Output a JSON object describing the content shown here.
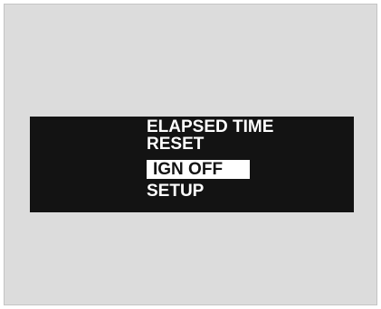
{
  "menu": {
    "items": [
      {
        "label": "ELAPSED TIME"
      },
      {
        "label": "RESET"
      },
      {
        "label": "IGN OFF",
        "selected": true
      },
      {
        "label": "SETUP"
      }
    ]
  },
  "colors": {
    "background": "#dcdcdc",
    "display": "#131313",
    "text": "#ffffff",
    "highlight": "#ffffff"
  }
}
